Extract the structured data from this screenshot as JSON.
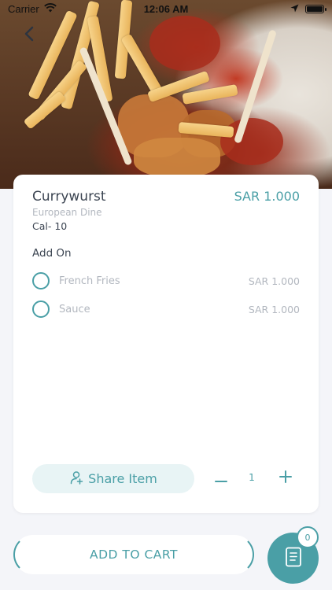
{
  "status_bar": {
    "carrier": "Carrier",
    "time": "12:06 AM"
  },
  "hero": {
    "image": "currywurst-with-fries-photo"
  },
  "item": {
    "name": "Currywurst",
    "price": "SAR 1.000",
    "restaurant": "European Dine",
    "calories": "Cal- 10"
  },
  "add_on": {
    "title": "Add On",
    "options": [
      {
        "label": "French Fries",
        "price": "SAR 1.000",
        "selected": false
      },
      {
        "label": "Sauce",
        "price": "SAR 1.000",
        "selected": false
      }
    ]
  },
  "actions": {
    "share_label": "Share Item",
    "quantity": "1",
    "add_to_cart_label": "ADD TO CART",
    "cart_count": "0"
  },
  "colors": {
    "accent": "#4a9fa6",
    "muted_text": "#b2b7bf",
    "dark_text": "#3c4552",
    "background": "#f4f5f9"
  },
  "icons": {
    "back": "chevron-left-icon",
    "share": "add-person-icon",
    "minus": "minus-icon",
    "plus": "plus-icon",
    "cart": "receipt-icon"
  }
}
